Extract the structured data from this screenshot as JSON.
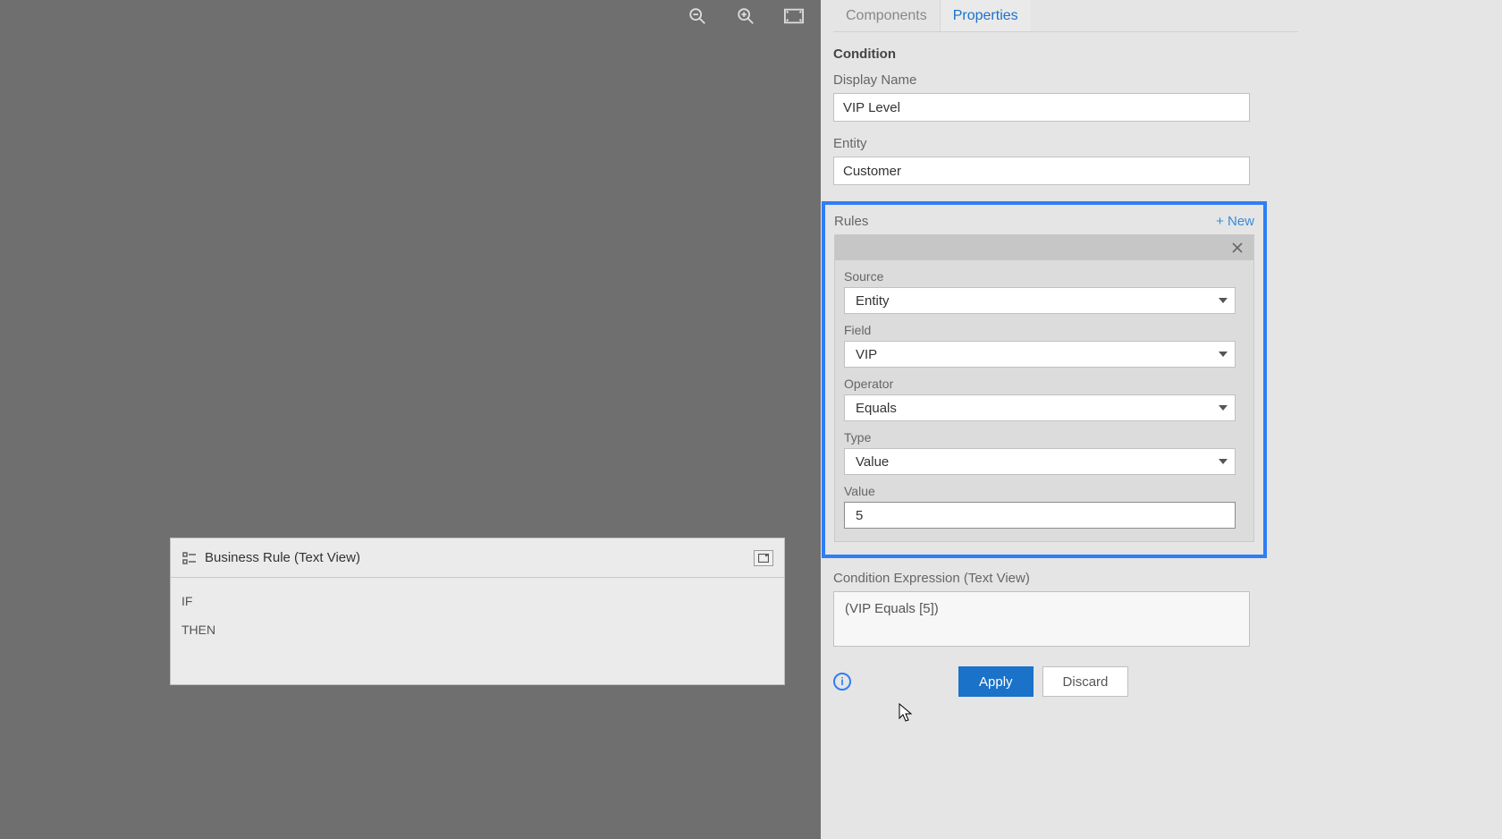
{
  "canvas": {
    "br_panel_title": "Business Rule (Text View)",
    "if_label": "IF",
    "then_label": "THEN"
  },
  "tabs": {
    "components": "Components",
    "properties": "Properties"
  },
  "properties": {
    "section_title": "Condition",
    "display_name_label": "Display Name",
    "display_name_value": "VIP Level",
    "entity_label": "Entity",
    "entity_value": "Customer",
    "rules_label": "Rules",
    "rules_new_label": "+ New",
    "rule": {
      "source_label": "Source",
      "source_value": "Entity",
      "field_label": "Field",
      "field_value": "VIP",
      "operator_label": "Operator",
      "operator_value": "Equals",
      "type_label": "Type",
      "type_value": "Value",
      "value_label": "Value",
      "value_value": "5"
    },
    "expr_label": "Condition Expression (Text View)",
    "expr_value": "(VIP Equals [5])",
    "apply_label": "Apply",
    "discard_label": "Discard"
  }
}
